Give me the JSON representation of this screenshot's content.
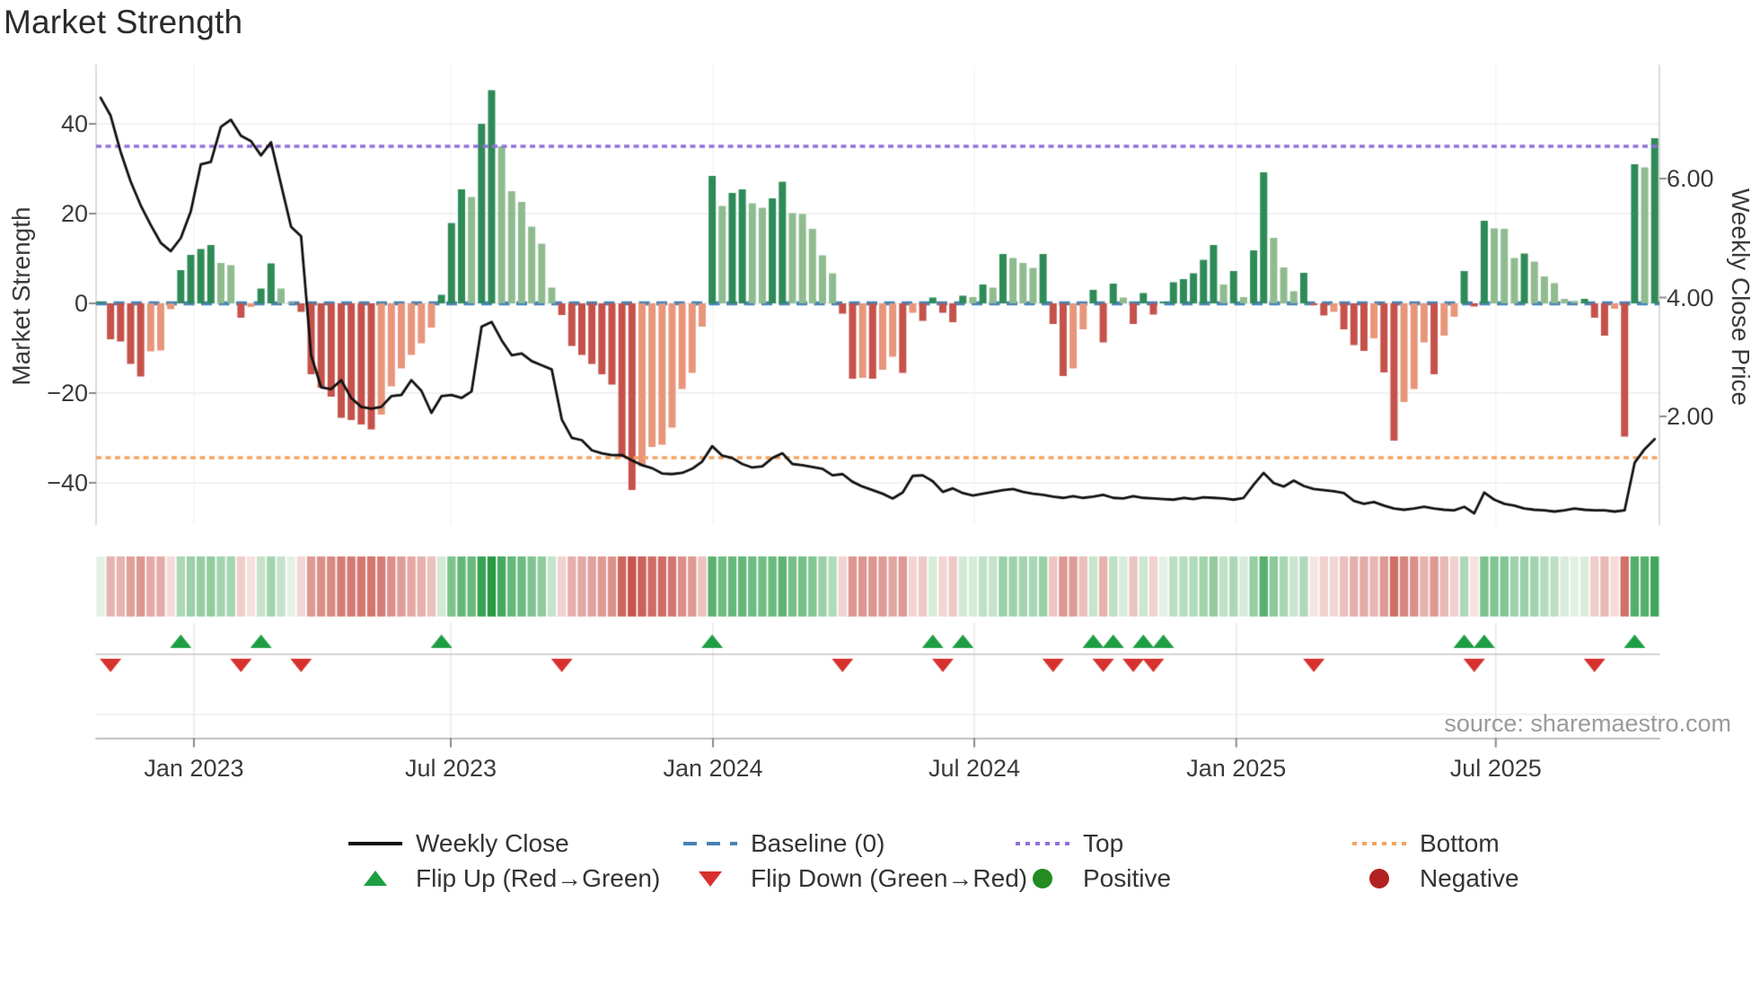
{
  "title": "Market Strength",
  "source": "source: sharemaestro.com",
  "axes": {
    "left": {
      "label": "Market Strength",
      "ticks": [
        "40",
        "20",
        "0",
        "−20",
        "−40"
      ],
      "tick_values": [
        40,
        20,
        0,
        -20,
        -40
      ]
    },
    "right": {
      "label": "Weekly Close Price",
      "ticks": [
        "6.00",
        "4.00",
        "2.00"
      ],
      "tick_values": [
        6,
        4,
        2
      ]
    },
    "x": {
      "ticks": [
        "Jan 2023",
        "Jul 2023",
        "Jan 2024",
        "Jul 2024",
        "Jan 2025",
        "Jul 2025"
      ],
      "tick_weeks": [
        9.31,
        34.93,
        61.08,
        87.14,
        113.27,
        139.15
      ]
    }
  },
  "legend": [
    {
      "label": "Weekly Close",
      "type": "line",
      "color": "#111111"
    },
    {
      "label": "Baseline (0)",
      "type": "dashes",
      "color": "#4682B4"
    },
    {
      "label": "Top",
      "type": "dots",
      "color": "#9370DB"
    },
    {
      "label": "Bottom",
      "type": "dots",
      "color": "#F4A460"
    },
    {
      "label": "Flip Up (Red→Green)",
      "type": "triangle-up",
      "color": "#1E9E43"
    },
    {
      "label": "Flip Down (Green→Red)",
      "type": "triangle-down",
      "color": "#D7312E"
    },
    {
      "label": "Positive",
      "type": "circle",
      "color": "#228B22"
    },
    {
      "label": "Negative",
      "type": "circle",
      "color": "#B22222"
    }
  ],
  "chart_data": {
    "type": "bar+line",
    "title": "Market Strength",
    "weeks": 156,
    "baseline": 0,
    "top_line": 35,
    "bottom_line": -34.4,
    "ylim_left": [
      -49.5,
      53
    ],
    "ylim_right": [
      0.15,
      7.9
    ],
    "grid": true,
    "legend_position": "bottom",
    "strength": [
      0.4,
      -8.0,
      -8.5,
      -13.5,
      -16.3,
      -10.7,
      -10.5,
      -1.3,
      7.4,
      10.8,
      12.1,
      13.0,
      9.0,
      8.5,
      -3.2,
      -0.8,
      3.3,
      8.9,
      3.3,
      0.3,
      -1.9,
      -15.8,
      -18.8,
      -20.8,
      -25.5,
      -26.0,
      -27.0,
      -28.1,
      -24.8,
      -18.5,
      -14.5,
      -11.5,
      -8.9,
      -5.4,
      1.9,
      17.9,
      25.4,
      23.7,
      40.0,
      47.5,
      35.0,
      25.0,
      22.6,
      17.1,
      13.3,
      3.5,
      -2.6,
      -9.5,
      -11.5,
      -13.5,
      -15.8,
      -18.1,
      -34.3,
      -41.6,
      -36.3,
      -32.0,
      -31.5,
      -27.7,
      -19.1,
      -15.5,
      -5.2,
      28.4,
      21.7,
      24.6,
      25.4,
      22.3,
      21.3,
      23.4,
      27.1,
      20.1,
      19.9,
      16.6,
      10.7,
      6.7,
      -2.3,
      -16.8,
      -16.6,
      -16.8,
      -14.8,
      -11.9,
      -15.5,
      -2.1,
      -3.9,
      1.3,
      -2.1,
      -4.2,
      1.7,
      1.4,
      4.2,
      3.5,
      11.0,
      10.1,
      9.0,
      7.9,
      11.0,
      -4.6,
      -16.2,
      -14.5,
      -5.8,
      3.0,
      -8.7,
      4.4,
      1.3,
      -4.6,
      2.3,
      -2.5,
      0.4,
      4.7,
      5.4,
      6.7,
      9.7,
      13.0,
      4.2,
      7.2,
      1.4,
      11.8,
      29.2,
      14.6,
      8.0,
      2.7,
      6.8,
      -0.4,
      -2.7,
      -1.9,
      -5.8,
      -9.3,
      -10.6,
      -7.8,
      -15.4,
      -30.6,
      -22.0,
      -19.1,
      -8.7,
      -15.8,
      -7.2,
      -3.0,
      7.2,
      -0.7,
      18.4,
      16.7,
      16.6,
      10.1,
      11.1,
      9.3,
      6.0,
      4.5,
      1.0,
      0.5,
      1.0,
      -3.2,
      -7.2,
      -1.2,
      -29.7,
      31.0,
      30.3,
      36.8
    ],
    "price": [
      7.36,
      7.06,
      6.45,
      5.95,
      5.55,
      5.22,
      4.92,
      4.78,
      5.0,
      5.45,
      6.24,
      6.28,
      6.87,
      6.99,
      6.72,
      6.63,
      6.39,
      6.61,
      5.9,
      5.19,
      5.03,
      3.03,
      2.49,
      2.46,
      2.61,
      2.31,
      2.16,
      2.13,
      2.16,
      2.34,
      2.36,
      2.61,
      2.43,
      2.06,
      2.34,
      2.36,
      2.31,
      2.42,
      3.51,
      3.59,
      3.28,
      3.03,
      3.06,
      2.93,
      2.86,
      2.79,
      1.95,
      1.64,
      1.6,
      1.43,
      1.38,
      1.35,
      1.35,
      1.26,
      1.18,
      1.13,
      1.04,
      1.03,
      1.05,
      1.12,
      1.24,
      1.5,
      1.34,
      1.3,
      1.2,
      1.14,
      1.16,
      1.3,
      1.38,
      1.2,
      1.18,
      1.15,
      1.12,
      1.01,
      1.03,
      0.9,
      0.82,
      0.76,
      0.7,
      0.62,
      0.72,
      1.0,
      1.01,
      0.91,
      0.73,
      0.79,
      0.71,
      0.67,
      0.7,
      0.73,
      0.76,
      0.78,
      0.73,
      0.7,
      0.68,
      0.65,
      0.63,
      0.66,
      0.63,
      0.65,
      0.68,
      0.63,
      0.62,
      0.66,
      0.63,
      0.62,
      0.61,
      0.6,
      0.63,
      0.61,
      0.64,
      0.63,
      0.62,
      0.6,
      0.63,
      0.85,
      1.05,
      0.88,
      0.82,
      0.92,
      0.83,
      0.78,
      0.76,
      0.74,
      0.71,
      0.58,
      0.53,
      0.56,
      0.5,
      0.45,
      0.43,
      0.45,
      0.48,
      0.45,
      0.43,
      0.42,
      0.48,
      0.37,
      0.72,
      0.6,
      0.53,
      0.5,
      0.45,
      0.43,
      0.42,
      0.4,
      0.42,
      0.45,
      0.43,
      0.42,
      0.42,
      0.4,
      0.42,
      1.22,
      1.45,
      1.62
    ],
    "colors": {
      "bar_pos_rising": "#2E8B57",
      "bar_pos_falling": "#8FBC8F",
      "bar_neg_falling": "#C5524B",
      "bar_neg_rising": "#E8967B",
      "baseline": "#4682B4",
      "top_line": "#9370DB",
      "bottom_line": "#F4A460",
      "price_line": "#111111",
      "flip_up": "#1E9E43",
      "flip_down": "#D7312E",
      "heat_pos_max": "#259A43",
      "heat_neg_max": "#C7554C"
    }
  }
}
